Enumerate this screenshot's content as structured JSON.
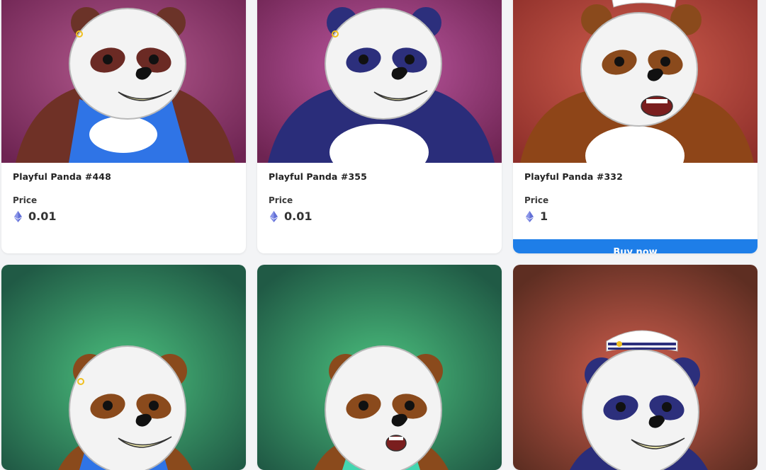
{
  "listings": [
    {
      "title": "Playful Panda #448",
      "price_label": "Price",
      "price": "0.01"
    },
    {
      "title": "Playful Panda #355",
      "price_label": "Price",
      "price": "0.01"
    },
    {
      "title": "Playful Panda #332",
      "price_label": "Price",
      "price": "1",
      "buy_label": "Buy now"
    }
  ],
  "currency_icon": "ethereum-icon",
  "colors": {
    "buy_button": "#1e7ee8",
    "card_bg": "#ffffff",
    "page_bg": "#f3f4f6",
    "eth_icon": "#6270d6"
  },
  "artwork": [
    {
      "background": "#8a2f66",
      "ears": "#6b3328",
      "eye_patches": "#6b2a24",
      "body": "#6f3126",
      "shirt": "#2f74e6"
    },
    {
      "background": "#8b2f6e",
      "ears": "#2c2f7c",
      "eye_patches": "#2c2f7c",
      "body": "#2a2d7a"
    },
    {
      "background": "#b8453f",
      "ears": "#8a4a1c",
      "eye_patches": "#8a4a1c",
      "body": "#8e4518",
      "hat": "sailor-hat"
    },
    {
      "background": "#37a064",
      "ears": "#8a4a1c",
      "eye_patches": "#8a4a1c",
      "body": "#8a4a1c",
      "shirt": "#2f74e6"
    },
    {
      "background": "#37a064",
      "ears": "#8a4a1c",
      "eye_patches": "#8a4a1c",
      "body": "#8a4a1c",
      "shirt": "#43d6b0"
    },
    {
      "background": "#b8453f",
      "ears": "#2c2f7c",
      "eye_patches": "#2c2f7c",
      "body": "#2a2d7a",
      "hat": "sailor-hat"
    }
  ]
}
